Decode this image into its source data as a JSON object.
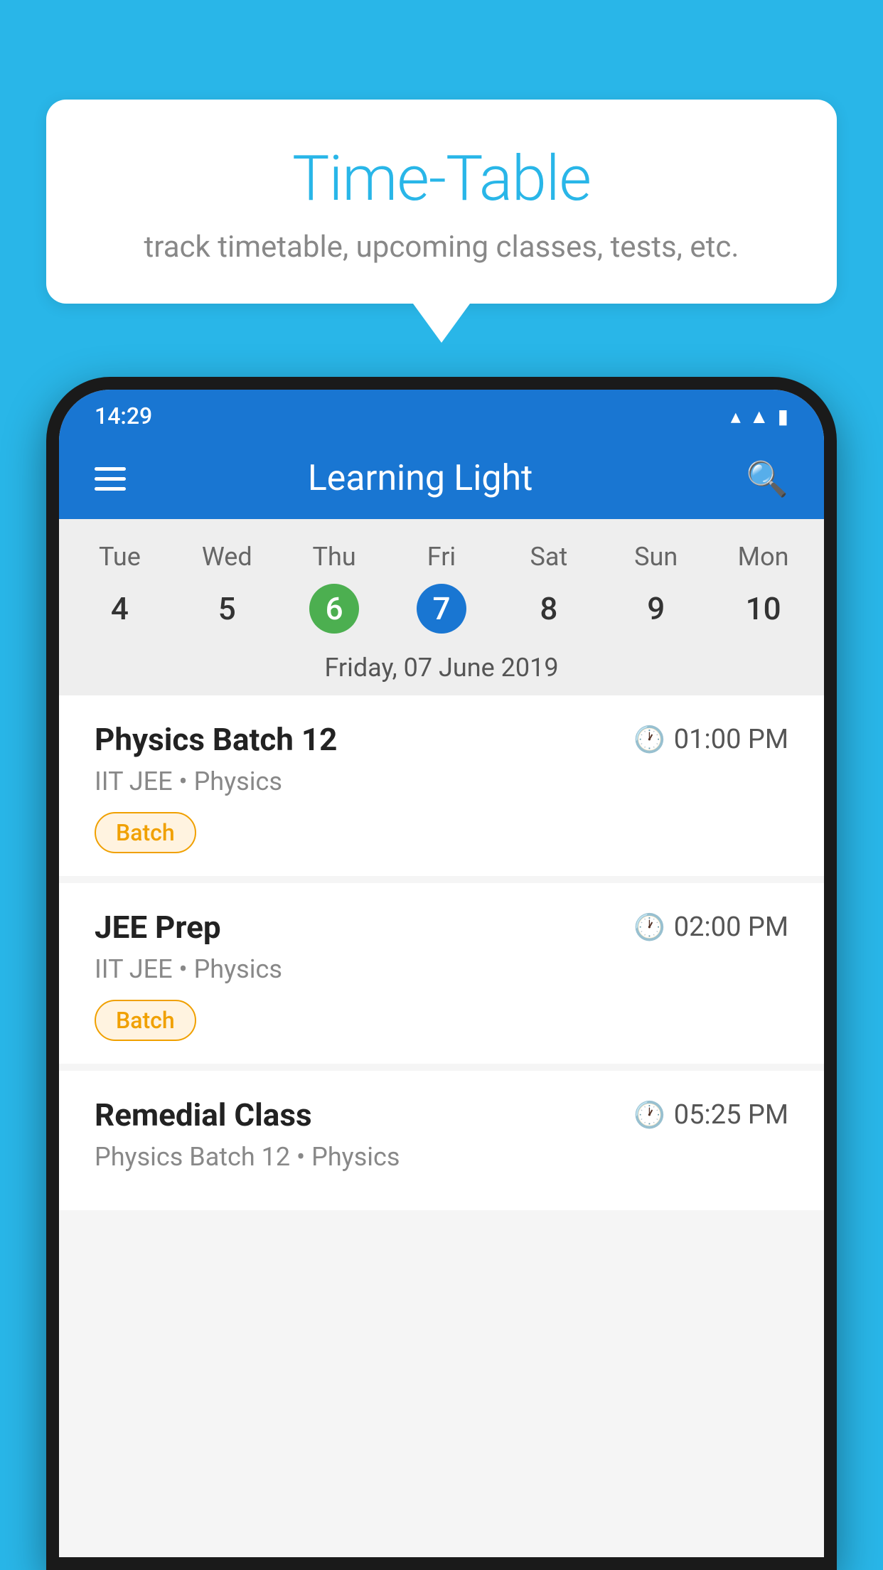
{
  "page": {
    "background_color": "#29b6e8"
  },
  "speech_bubble": {
    "title": "Time-Table",
    "subtitle": "track timetable, upcoming classes, tests, etc."
  },
  "app_bar": {
    "title": "Learning Light",
    "menu_label": "Menu",
    "search_label": "Search"
  },
  "status_bar": {
    "time": "14:29"
  },
  "calendar": {
    "days": [
      {
        "label": "Tue",
        "number": "4"
      },
      {
        "label": "Wed",
        "number": "5"
      },
      {
        "label": "Thu",
        "number": "6",
        "state": "today"
      },
      {
        "label": "Fri",
        "number": "7",
        "state": "selected"
      },
      {
        "label": "Sat",
        "number": "8"
      },
      {
        "label": "Sun",
        "number": "9"
      },
      {
        "label": "Mon",
        "number": "10"
      }
    ],
    "selected_date_label": "Friday, 07 June 2019"
  },
  "schedule": {
    "items": [
      {
        "title": "Physics Batch 12",
        "time": "01:00 PM",
        "subtitle": "IIT JEE • Physics",
        "badge": "Batch"
      },
      {
        "title": "JEE Prep",
        "time": "02:00 PM",
        "subtitle": "IIT JEE • Physics",
        "badge": "Batch"
      },
      {
        "title": "Remedial Class",
        "time": "05:25 PM",
        "subtitle": "Physics Batch 12 • Physics",
        "badge": ""
      }
    ]
  }
}
